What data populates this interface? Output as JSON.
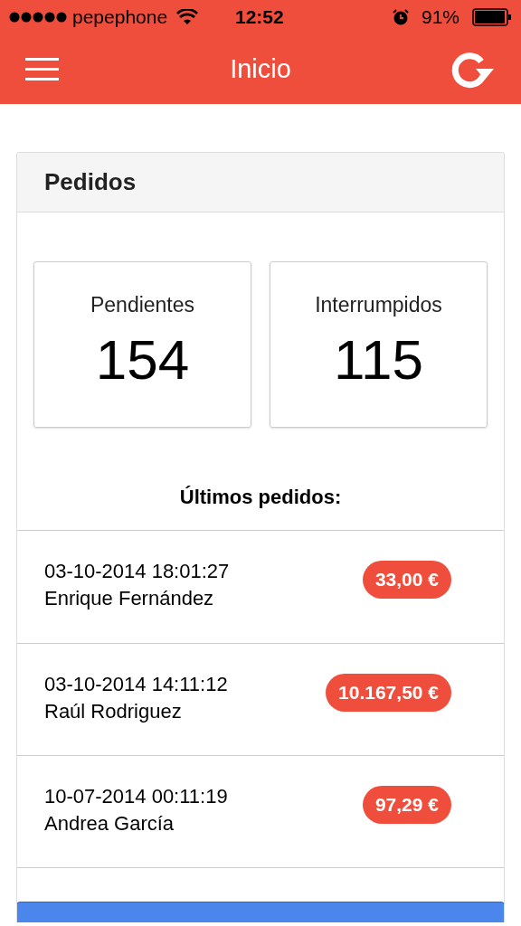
{
  "status_bar": {
    "carrier": "pepephone",
    "time": "12:52",
    "battery": "91%"
  },
  "nav_bar": {
    "title": "Inicio"
  },
  "panel": {
    "title": "Pedidos",
    "stats": [
      {
        "label": "Pendientes",
        "value": "154"
      },
      {
        "label": "Interrumpidos",
        "value": "115"
      }
    ],
    "recent_title": "Últimos pedidos:",
    "orders": [
      {
        "date": "03-10-2014 18:01:27",
        "customer": "Enrique Fernández",
        "amount": "33,00 €"
      },
      {
        "date": "03-10-2014 14:11:12",
        "customer": "Raúl Rodriguez",
        "amount": "10.167,50 €"
      },
      {
        "date": "10-07-2014 00:11:19",
        "customer": "Andrea García",
        "amount": "97,29 €"
      }
    ]
  }
}
